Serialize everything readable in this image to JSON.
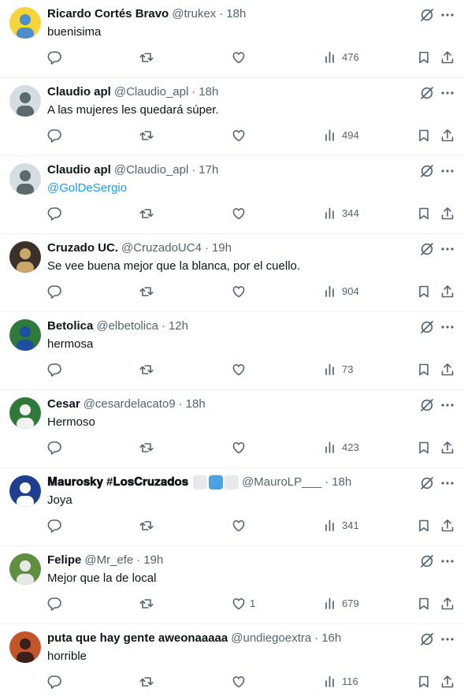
{
  "tweets": [
    {
      "name": "Ricardo Cortés Bravo",
      "handle": "@trukex",
      "dot": "·",
      "time": "18h",
      "text": "buenisima",
      "likes": "",
      "views": "476",
      "avatar_colors": [
        "#f6d43c",
        "#4a8ecb"
      ]
    },
    {
      "name": "Claudio apl",
      "handle": "@Claudio_apl",
      "dot": "·",
      "time": "18h",
      "text": "A las mujeres les quedará súper.",
      "likes": "",
      "views": "494",
      "avatar_colors": [
        "#d5dde0",
        "#5b6a6d"
      ]
    },
    {
      "name": "Claudio apl",
      "handle": "@Claudio_apl",
      "dot": "·",
      "time": "17h",
      "text": "@GolDeSergio",
      "likes": "",
      "views": "344",
      "avatar_colors": [
        "#d5dde0",
        "#5b6a6d"
      ]
    },
    {
      "name": "Cruzado UC.",
      "handle": "@CruzadoUC4",
      "dot": "·",
      "time": "19h",
      "text": "Se vee buena mejor que la blanca, por el cuello.",
      "likes": "",
      "views": "904",
      "avatar_colors": [
        "#3b3128",
        "#c9a86a"
      ]
    },
    {
      "name": "Betolica",
      "handle": "@elbetolica",
      "dot": "·",
      "time": "12h",
      "text": "hermosa",
      "likes": "",
      "views": "73",
      "avatar_colors": [
        "#2f7a3a",
        "#1e4fa0"
      ]
    },
    {
      "name": "Cesar",
      "handle": "@cesardelacato9",
      "dot": "·",
      "time": "18h",
      "text": "Hermoso",
      "likes": "",
      "views": "423",
      "avatar_colors": [
        "#2f7a3a",
        "#f2f2f2"
      ]
    },
    {
      "name": "𝐌𝐚𝐮𝐫𝐨𝐬𝐤𝐲 #𝐋𝐨𝐬𝐂𝐫𝐮𝐳𝐚𝐝𝐨𝐬",
      "handle": "@MauroLP___",
      "dot": "·",
      "time": "18h",
      "text": "Joya",
      "likes": "",
      "views": "341",
      "avatar_colors": [
        "#1e3f8f",
        "#ffffff"
      ]
    },
    {
      "name": "Felipe",
      "handle": "@Mr_efe",
      "dot": "·",
      "time": "19h",
      "text": "Mejor que la de local",
      "likes": "1",
      "views": "679",
      "avatar_colors": [
        "#5f8f3f",
        "#e8e8e8"
      ]
    },
    {
      "name": "puta que hay gente aweonaaaaa",
      "handle": "@undiegoextra",
      "dot": "·",
      "time": "16h",
      "text": "horrible",
      "likes": "",
      "views": "116",
      "avatar_colors": [
        "#c2562a",
        "#3a1f1a"
      ]
    }
  ],
  "badge_colors": [
    "#e7e9ea",
    "#4aa3df",
    "#e7e9ea"
  ],
  "icons": {
    "reply": "reply-icon",
    "retweet": "retweet-icon",
    "like": "heart-icon",
    "views": "views-chart-icon",
    "bookmark": "bookmark-icon",
    "share": "share-icon",
    "grok": "grok-icon",
    "more": "more-icon"
  }
}
